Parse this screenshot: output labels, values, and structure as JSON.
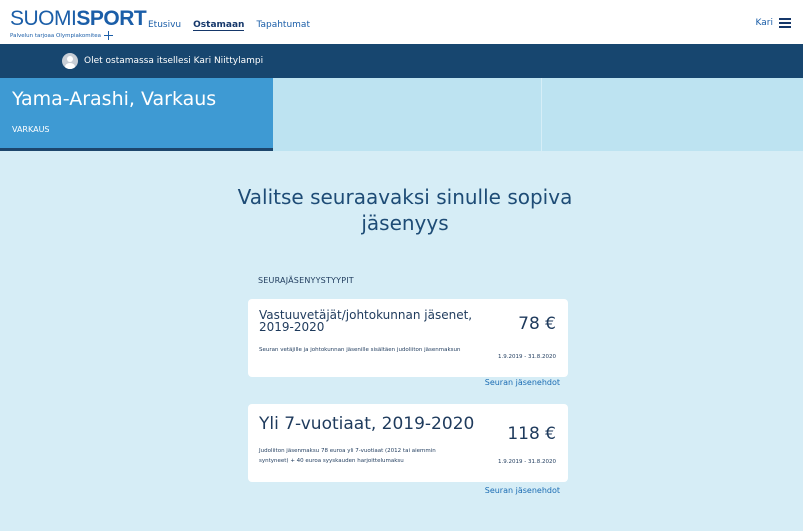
{
  "header": {
    "logo": {
      "part1": "SUOMI",
      "part2": "SPORT",
      "tagline": "Palvelun tarjoaa Olympiakomitea"
    },
    "nav": [
      {
        "label": "Etusivu",
        "active": false
      },
      {
        "label": "Ostamaan",
        "active": true
      },
      {
        "label": "Tapahtumat",
        "active": false
      }
    ],
    "user_name": "Kari",
    "menu_icon": "hamburger-icon"
  },
  "buying_for": {
    "text": "Olet ostamassa itsellesi Kari Niittylampi",
    "icon": "avatar-icon"
  },
  "club": {
    "name": "Yama-Arashi, Varkaus",
    "city": "VARKAUS"
  },
  "main": {
    "heading": "Valitse seuraavaksi sinulle sopiva jäsenyys",
    "section_label": "SEURAJÄSENYYSTYYPIT",
    "memberships": [
      {
        "title": "Vastuuvetäjät/johtokunnan jäsenet, 2019-2020",
        "price": "78 €",
        "description": "Seuran vetäjille ja johtokunnan jäsenille sisältäen judoliiton jäsenmaksun",
        "dates": "1.9.2019 - 31.8.2020",
        "terms_link": "Seuran jäsenehdot"
      },
      {
        "title": "Yli 7-vuotiaat, 2019-2020",
        "price": "118 €",
        "description": "Judoliiton jäsenmaksu 78 euroa yli 7-vuotiaat (2012 tai aiemmin syntyneet) + 40 euroa syyskauden harjoittelumaksu",
        "dates": "1.9.2019 - 31.8.2020",
        "terms_link": "Seuran jäsenehdot"
      }
    ]
  },
  "colors": {
    "background": "#d6edf6",
    "nav_dark": "#17466f",
    "club_accent": "#3e9ad3",
    "text_dark": "#1e3a5c",
    "link": "#1b6cb3"
  }
}
